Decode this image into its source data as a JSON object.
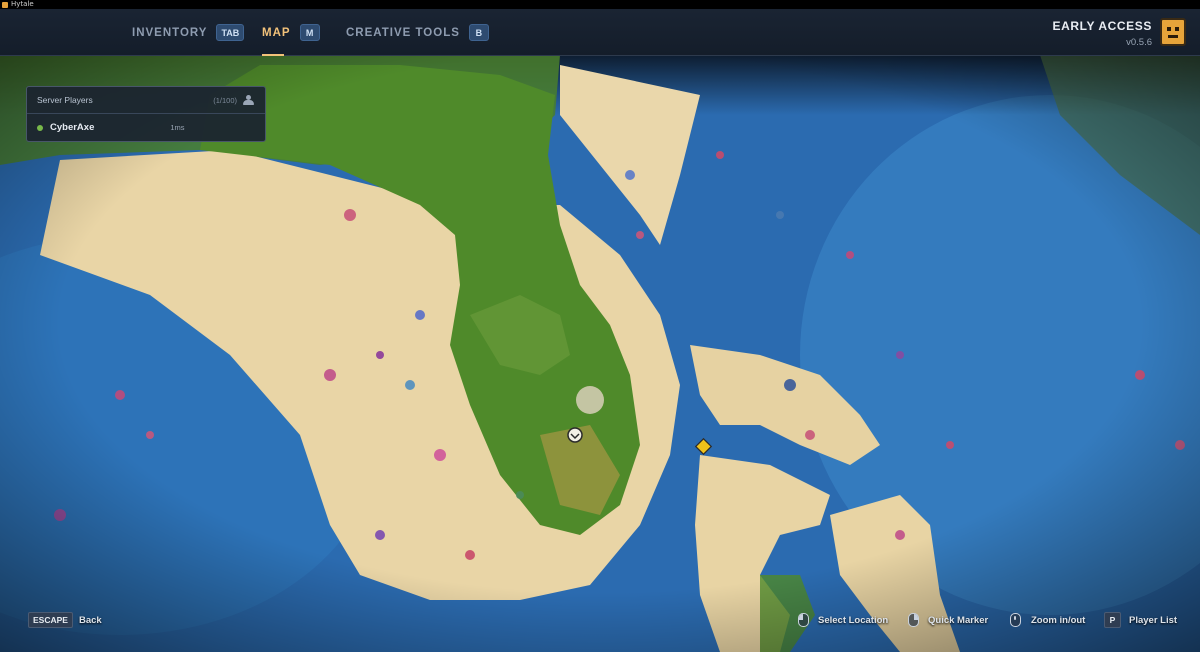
{
  "window": {
    "title": "Hytale"
  },
  "nav": {
    "tabs": [
      {
        "label": "INVENTORY",
        "key": "TAB",
        "active": false
      },
      {
        "label": "MAP",
        "key": "M",
        "active": true
      },
      {
        "label": "CREATIVE TOOLS",
        "key": "B",
        "active": false
      }
    ]
  },
  "brand": {
    "title": "EARLY ACCESS",
    "version": "v0.5.6"
  },
  "players_panel": {
    "title": "Server Players",
    "count": "(1/100)",
    "players": [
      {
        "name": "CyberAxe",
        "ping": "1ms",
        "status_color": "#78b94a"
      }
    ]
  },
  "controls": {
    "escape": {
      "key": "ESCAPE",
      "label": "Back"
    },
    "select": {
      "icon": "mouse-left-icon",
      "label": "Select Location"
    },
    "marker": {
      "icon": "mouse-right-icon",
      "label": "Quick Marker"
    },
    "zoom": {
      "icon": "mouse-wheel-icon",
      "label": "Zoom in/out"
    },
    "players": {
      "key": "P",
      "label": "Player List"
    }
  },
  "colors": {
    "ocean": "#2f6fb3",
    "deep_ocean": "#1b4f8c",
    "sand": "#e9d6a8",
    "grass": "#4f8a2a",
    "accent": "#f2c27a"
  }
}
